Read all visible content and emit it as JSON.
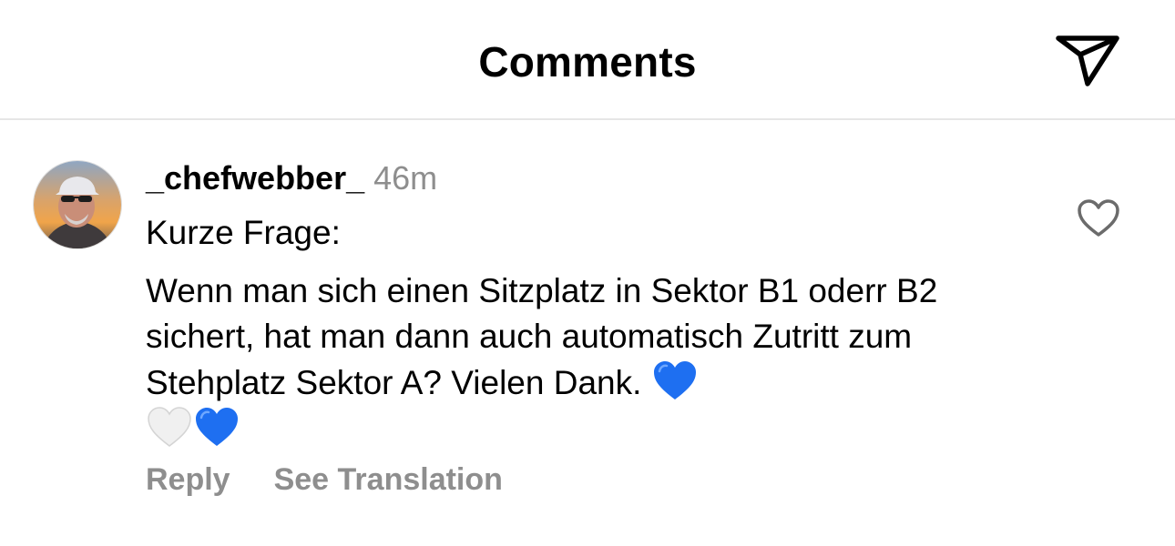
{
  "header": {
    "title": "Comments",
    "share_icon": "paper-plane-icon"
  },
  "comment": {
    "username": "_chefwebber_",
    "timestamp": "46m",
    "body_line1": "Kurze Frage:",
    "body_line2": "Wenn man sich einen Sitzplatz in Sektor B1 oderr B2 sichert, hat man dann auch automatisch Zutritt zum Stehplatz Sektor A? Vielen Dank.",
    "emojis": [
      "blue-heart",
      "white-heart",
      "blue-heart"
    ],
    "like_icon": "heart-outline-icon",
    "reply_label": "Reply",
    "translate_label": "See Translation"
  },
  "colors": {
    "text": "#000000",
    "secondary_text": "#8e8e8e",
    "divider": "#e6e6e6",
    "blue_heart": "#1e6ff1",
    "white_heart": "#f0f0f0"
  }
}
